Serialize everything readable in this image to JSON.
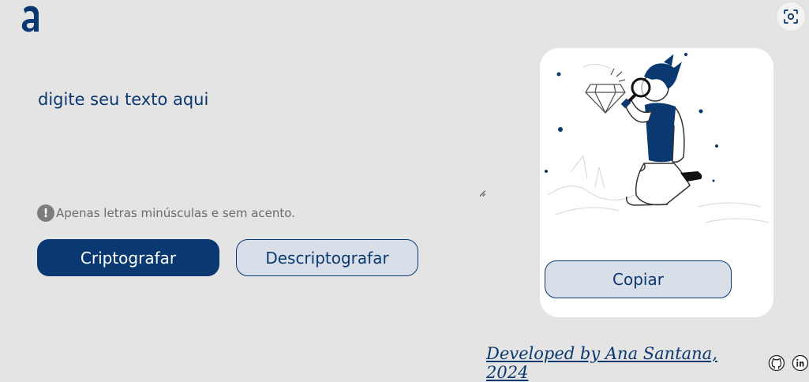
{
  "header": {
    "logo_icon": "alura-a-logo-icon",
    "screenshot_icon": "screenshot-capture-icon"
  },
  "editor": {
    "placeholder": "digite seu texto aqui"
  },
  "hint": {
    "icon": "exclamation-icon",
    "text": "Apenas letras minúsculas e sem acento."
  },
  "actions": {
    "encrypt_label": "Criptografar",
    "decrypt_label": "Descriptografar"
  },
  "output": {
    "illustration_icon": "boy-with-magnifier-illustration",
    "copy_label": "Copiar"
  },
  "footer": {
    "credit": "Developed by Ana Santana, 2024",
    "github_icon": "github-icon",
    "linkedin_icon": "linkedin-icon"
  },
  "colors": {
    "primary": "#0a3871",
    "background": "#e4e4e4",
    "secondary_button": "#d8dfe8",
    "hint": "#6b6b6b"
  }
}
